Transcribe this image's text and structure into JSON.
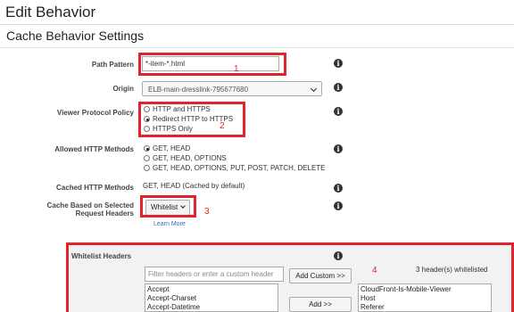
{
  "page": {
    "title": "Edit Behavior",
    "section_title": "Cache Behavior Settings"
  },
  "fields": {
    "path_pattern": {
      "label": "Path Pattern",
      "value": "*-item-*.html"
    },
    "origin": {
      "label": "Origin",
      "value": "ELB-main-dresslink-795677680"
    },
    "viewer_protocol_policy": {
      "label": "Viewer Protocol Policy",
      "options": [
        "HTTP and HTTPS",
        "Redirect HTTP to HTTPS",
        "HTTPS Only"
      ],
      "selected": 1
    },
    "allowed_http_methods": {
      "label": "Allowed HTTP Methods",
      "options": [
        "GET, HEAD",
        "GET, HEAD, OPTIONS",
        "GET, HEAD, OPTIONS, PUT, POST, PATCH, DELETE"
      ],
      "selected": 0
    },
    "cached_http_methods": {
      "label": "Cached HTTP Methods",
      "value": "GET, HEAD (Cached by default)"
    },
    "cache_based_on_headers": {
      "label_line1": "Cache Based on Selected",
      "label_line2": "Request Headers",
      "value": "Whitelist",
      "learn_more": "Learn More"
    }
  },
  "whitelist": {
    "title": "Whitelist Headers",
    "filter_placeholder": "Filter headers or enter a custom header",
    "add_custom_label": "Add Custom >>",
    "add_label": "Add >>",
    "count_text": "3 header(s) whitelisted",
    "available": [
      "Accept",
      "Accept-Charset",
      "Accept-Datetime"
    ],
    "selected": [
      "CloudFront-Is-Mobile-Viewer",
      "Host",
      "Referer"
    ]
  },
  "annotations": {
    "n1": "1",
    "n2": "2",
    "n3": "3",
    "n4": "4",
    "color": "#e0242b"
  },
  "icons": {
    "info": "info-icon",
    "dropdown": "chevron-down-icon",
    "list_scroll": "scroll-arrow-icon"
  }
}
